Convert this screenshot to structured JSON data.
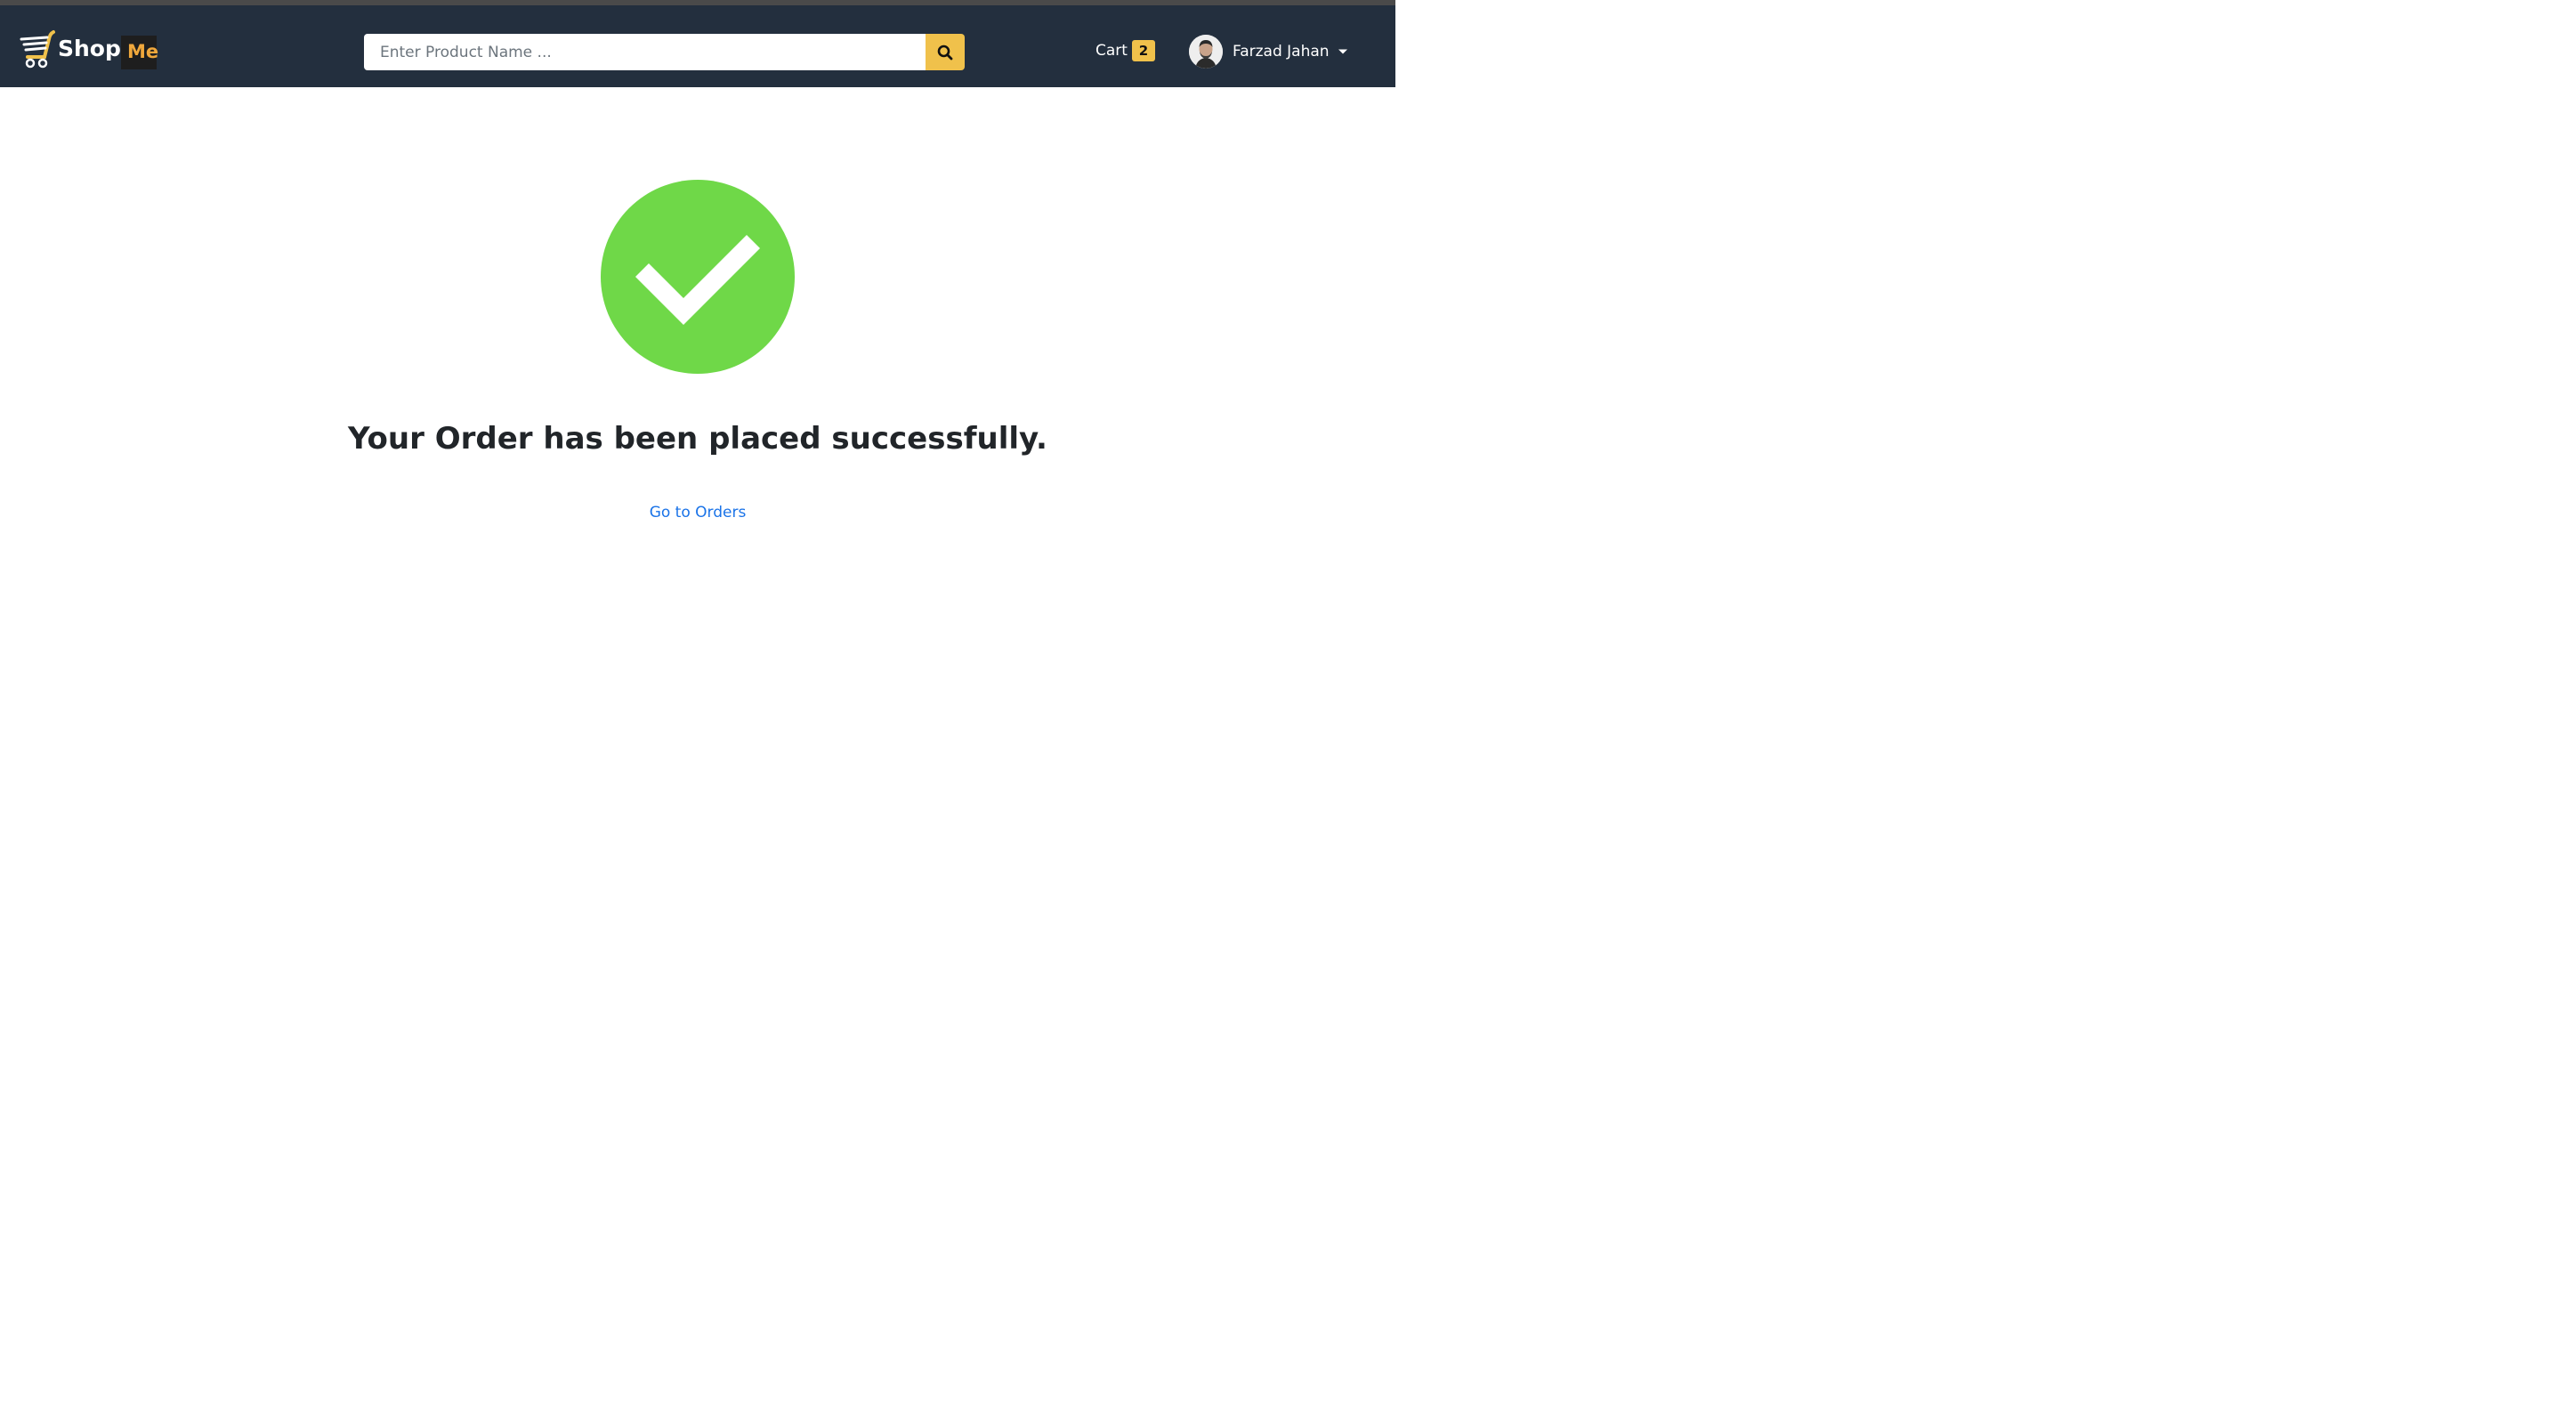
{
  "brand": {
    "name_part1": "Shop",
    "name_part2": "Me"
  },
  "search": {
    "placeholder": "Enter Product Name ...",
    "value": "",
    "button_icon": "search-icon"
  },
  "cart": {
    "label": "Cart",
    "count": "2"
  },
  "user": {
    "name": "Farzad Jahan",
    "menu_icon": "caret-down-icon"
  },
  "main": {
    "status_icon": "check-circle-icon",
    "message": "Your Order has been placed successfully.",
    "link_label": "Go to Orders"
  },
  "colors": {
    "navbar": "#232f3e",
    "accent": "#f0c14b",
    "success": "#6fd848",
    "link": "#1a73e8"
  }
}
